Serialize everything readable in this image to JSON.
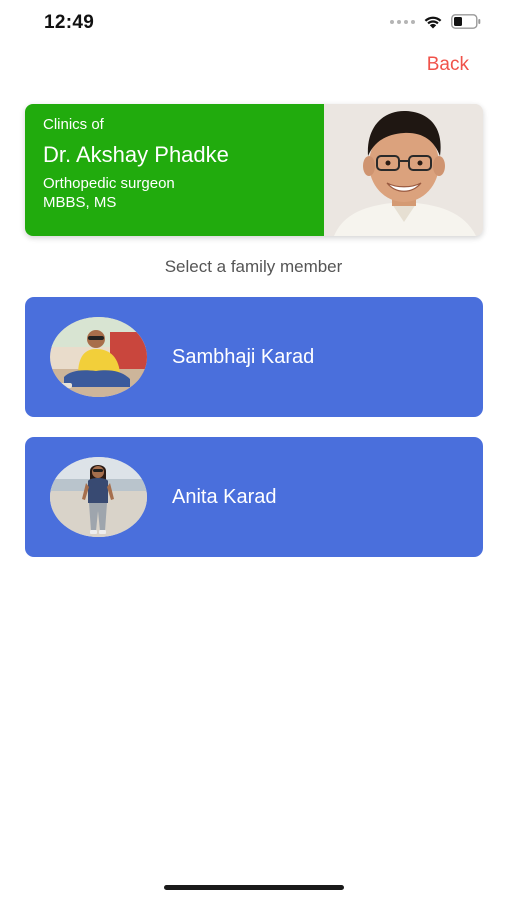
{
  "status_bar": {
    "time": "12:49",
    "icons": [
      "signal-icon",
      "wifi-icon",
      "battery-icon"
    ]
  },
  "header": {
    "back_label": "Back",
    "accent_color": "#f0524a"
  },
  "doctor_card": {
    "clinics_label": "Clinics of",
    "name": "Dr. Akshay Phadke",
    "specialty": "Orthopedic surgeon",
    "degree": "MBBS, MS",
    "background_color": "#21ab0d"
  },
  "prompt": "Select a family member",
  "members": [
    {
      "name": "Sambhaji Karad"
    },
    {
      "name": "Anita Karad"
    }
  ],
  "colors": {
    "member_card": "#4a6fdc",
    "text_on_card": "#ffffff"
  }
}
